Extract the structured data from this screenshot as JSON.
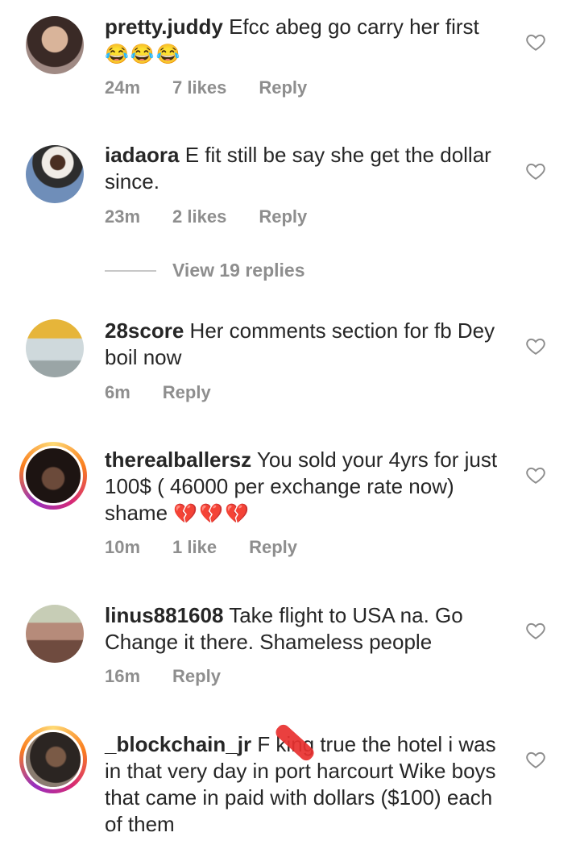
{
  "comments": [
    {
      "username": "pretty.juddy",
      "text": "Efcc abeg go carry her first",
      "emoji": "😂😂😂",
      "time": "24m",
      "likes": "7 likes",
      "reply": "Reply"
    },
    {
      "username": "iadaora",
      "text": "E fit still be say she get the dollar since.",
      "time": "23m",
      "likes": "2 likes",
      "reply": "Reply"
    },
    {
      "username": "28score",
      "text": "Her comments section for fb Dey boil now",
      "time": "6m",
      "reply": "Reply"
    },
    {
      "username": "therealballersz",
      "text": "You sold your 4yrs for just  100$ ( 46000 per exchange rate now) shame",
      "emoji": "💔💔💔",
      "time": "10m",
      "likes": "1 like",
      "reply": "Reply"
    },
    {
      "username": "linus881608",
      "text": "Take flight to USA na. Go Change it there. Shameless people",
      "time": "16m",
      "reply": "Reply"
    },
    {
      "username": "_blockchain_jr",
      "text": "F  king true the hotel i was in that very day in port harcourt Wike boys that came in paid with dollars ($100) each of them"
    }
  ],
  "view_replies": "View 19 replies",
  "colors": {
    "muted": "#8e8e8e",
    "text": "#262626",
    "redaction": "#e8302f"
  },
  "icons": {
    "like": "heart-outline-icon"
  }
}
